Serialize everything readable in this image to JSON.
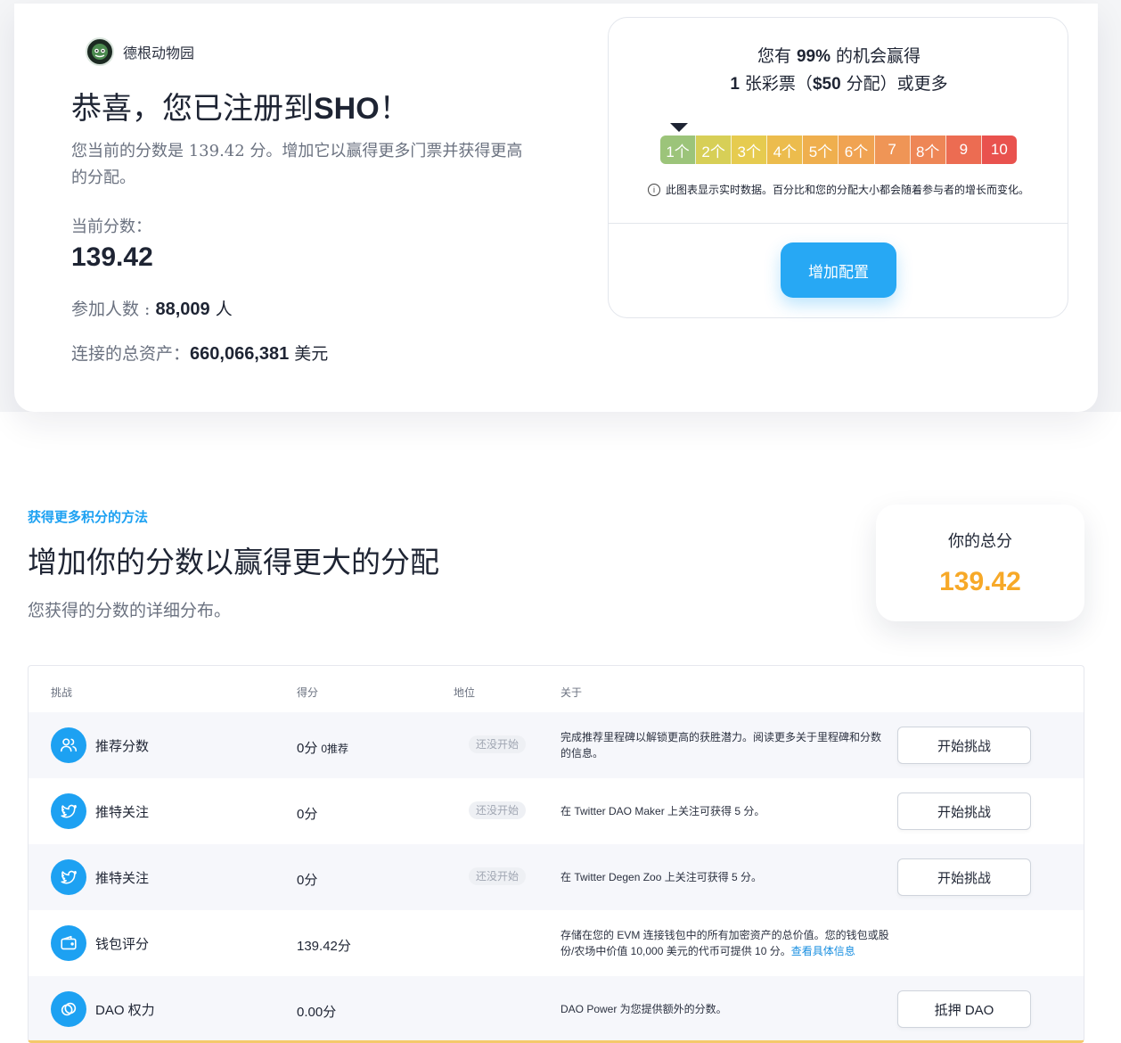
{
  "project": {
    "name": "德根动物园"
  },
  "hero": {
    "title_prefix": "恭喜，您已注册到",
    "title_token": "SHO",
    "title_suffix": "！",
    "description": "您当前的分数是 139.42 分。增加它以赢得更多门票并获得更高的分配。",
    "current_score_label": "当前分数：",
    "current_score": "139.42",
    "participants_label": "参加人数 : ",
    "participants_value": "88,009",
    "participants_unit": " 人",
    "assets_label": "连接的总资产：",
    "assets_value": "660,066,381",
    "assets_unit": " 美元"
  },
  "chance": {
    "line1_prefix": "您有 ",
    "line1_pct": "99%",
    "line1_suffix": " 的机会赢得",
    "line2_num": "1",
    "line2_a": " 张彩票（",
    "line2_amount": "$50",
    "line2_b": " 分配）或更多",
    "ticket_current": 1,
    "scale": [
      {
        "label": "1个",
        "color": "#9cc47a"
      },
      {
        "label": "2个",
        "color": "#d7cf57"
      },
      {
        "label": "3个",
        "color": "#e6cb4f"
      },
      {
        "label": "4个",
        "color": "#ecbc4d"
      },
      {
        "label": "5个",
        "color": "#efaf4e"
      },
      {
        "label": "6个",
        "color": "#f0a352"
      },
      {
        "label": "7",
        "color": "#ef9556"
      },
      {
        "label": "8个",
        "color": "#ee8656"
      },
      {
        "label": "9",
        "color": "#ec6c52"
      },
      {
        "label": "10",
        "color": "#e9524e"
      }
    ],
    "note": "此图表显示实时数据。百分比和您的分配大小都会随着参与者的增长而变化。",
    "button": "增加配置"
  },
  "section": {
    "eyebrow": "获得更多积分的方法",
    "title": "增加你的分数以赢得更大的分配",
    "desc": "您获得的分数的详细分布。"
  },
  "total": {
    "label": "你的总分",
    "value": "139.42"
  },
  "table": {
    "headers": [
      "挑战",
      "得分",
      "地位",
      "关于"
    ],
    "rows": [
      {
        "icon": "users-icon",
        "name": "推荐分数",
        "points": "0分",
        "points_extra": "0推荐",
        "status": "还没开始",
        "about": "完成推荐里程碑以解锁更高的获胜潜力。阅读更多关于里程碑和分数的信息。",
        "about_link": "",
        "action": "开始挑战"
      },
      {
        "icon": "twitter-icon",
        "name": "推特关注",
        "points": "0分",
        "points_extra": "",
        "status": "还没开始",
        "about": "在 Twitter DAO Maker 上关注可获得 5 分。",
        "about_link": "",
        "action": "开始挑战"
      },
      {
        "icon": "twitter-icon",
        "name": "推特关注",
        "points": "0分",
        "points_extra": "",
        "status": "还没开始",
        "about": "在 Twitter Degen Zoo 上关注可获得 5 分。",
        "about_link": "",
        "action": "开始挑战"
      },
      {
        "icon": "wallet-icon",
        "name": "钱包评分",
        "points": "139.42分",
        "points_extra": "",
        "status": "",
        "about": "存储在您的 EVM 连接钱包中的所有加密资产的总价值。您的钱包或股份/农场中价值 10,000 美元的代币可提供 10 分。",
        "about_link": "查看具体信息",
        "action": ""
      },
      {
        "icon": "dao-icon",
        "name": "DAO 权力",
        "points": "0.00分",
        "points_extra": "",
        "status": "",
        "about": "DAO Power 为您提供额外的分数。",
        "about_link": "",
        "action": "抵押 DAO"
      }
    ]
  }
}
